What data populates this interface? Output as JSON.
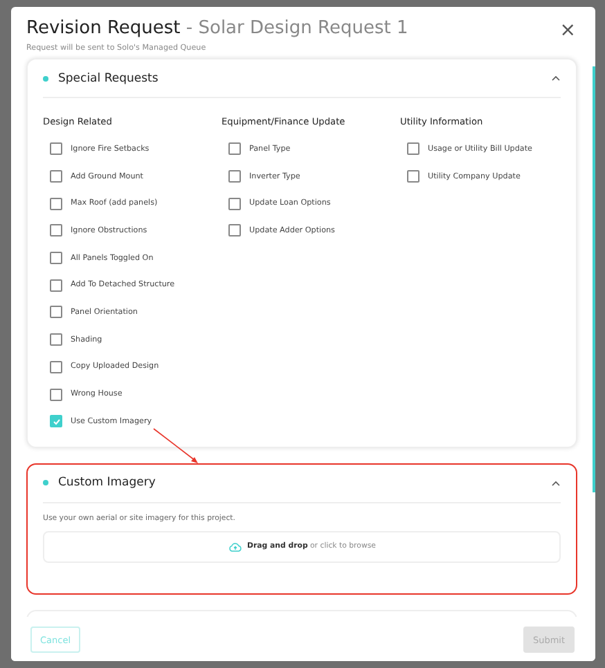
{
  "dialog": {
    "title": "Revision Request",
    "title_suffix": " - Solar Design Request 1",
    "subtitle": "Request will be sent to Solo's Managed Queue",
    "close_icon": "×"
  },
  "sections": [
    {
      "title": "Special Requests",
      "expanded": true,
      "highlighted": false,
      "columns": [
        {
          "heading": "Design Related",
          "options": [
            {
              "label": "Ignore Fire Setbacks",
              "checked": false
            },
            {
              "label": "Add Ground Mount",
              "checked": false
            },
            {
              "label": "Max Roof (add panels)",
              "checked": false
            },
            {
              "label": "Ignore Obstructions",
              "checked": false
            },
            {
              "label": "All Panels Toggled On",
              "checked": false
            },
            {
              "label": "Add To Detached Structure",
              "checked": false
            },
            {
              "label": "Panel Orientation",
              "checked": false
            },
            {
              "label": "Shading",
              "checked": false
            },
            {
              "label": "Copy Uploaded Design",
              "checked": false
            },
            {
              "label": "Wrong House",
              "checked": false
            },
            {
              "label": "Use Custom Imagery",
              "checked": true
            }
          ]
        },
        {
          "heading": "Equipment/Finance Update",
          "options": [
            {
              "label": "Panel Type",
              "checked": false
            },
            {
              "label": "Inverter Type",
              "checked": false
            },
            {
              "label": "Update Loan Options",
              "checked": false
            },
            {
              "label": "Update Adder Options",
              "checked": false
            }
          ]
        },
        {
          "heading": "Utility Information",
          "options": [
            {
              "label": "Usage or Utility Bill Update",
              "checked": false
            },
            {
              "label": "Utility Company Update",
              "checked": false
            }
          ]
        }
      ]
    },
    {
      "title": "Custom Imagery",
      "expanded": true,
      "highlighted": true,
      "description": "Use your own aerial or site imagery for this project.",
      "dropzone": "**Drag and drop** or click to browse"
    }
  ],
  "footer": {
    "cancel": "Cancel",
    "submit": "Submit",
    "submit_disabled": true
  }
}
